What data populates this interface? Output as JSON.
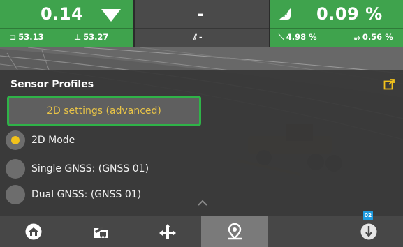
{
  "status": {
    "left": {
      "value": "0.14",
      "sub_left": "53.13",
      "sub_right": "53.27",
      "sub_left_icon": "blade-left-elevation-icon",
      "sub_right_icon": "blade-right-elevation-icon",
      "indicator": "down-arrow-icon",
      "color": "#3fa34d"
    },
    "middle": {
      "value": "-",
      "sub": "-",
      "sub_icon": "cross-slope-icon",
      "color": "#4a4a4a"
    },
    "right": {
      "value": "0.09 %",
      "sub_left": "4.98 %",
      "sub_right": "0.56 %",
      "icon": "slope-icon",
      "color": "#3fa34d"
    }
  },
  "sensor_profiles": {
    "title": "Sensor Profiles",
    "advanced_button": "2D settings (advanced)",
    "options": [
      {
        "label": "2D Mode",
        "selected": true
      },
      {
        "label": "Single GNSS: (GNSS 01)",
        "selected": false
      },
      {
        "label": "Dual GNSS: (GNSS 01)",
        "selected": false
      }
    ],
    "accent_color": "#2fb348",
    "selected_color": "#f2c21b"
  },
  "bottom_nav": {
    "items": [
      {
        "name": "home-icon",
        "active": false
      },
      {
        "name": "folder-machine-icon",
        "active": false
      },
      {
        "name": "cross-arrows-icon",
        "active": false
      },
      {
        "name": "location-pin-icon",
        "active": true
      },
      {
        "name": "blank",
        "active": false
      },
      {
        "name": "gnss-receiver-icon",
        "active": false
      }
    ],
    "badge": "02"
  }
}
